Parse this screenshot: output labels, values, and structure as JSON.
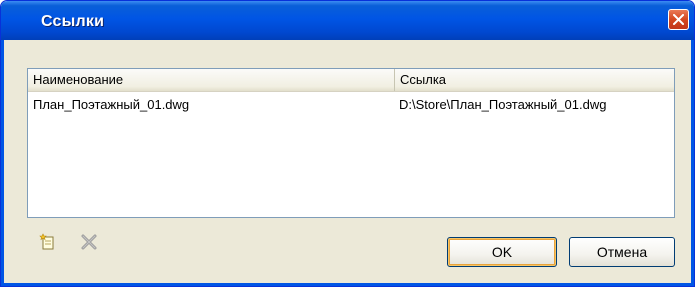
{
  "window": {
    "title": "Ссылки",
    "close_icon": "close-x-icon",
    "accent_color": "#0055e5"
  },
  "list": {
    "columns": [
      {
        "label": "Наименование"
      },
      {
        "label": "Ссылка"
      }
    ],
    "rows": [
      {
        "name": "План_Поэтажный_01.dwg",
        "link": "D:\\Store\\План_Поэтажный_01.dwg"
      }
    ]
  },
  "toolbar": {
    "add_icon": "new-link-icon",
    "delete_icon": "delete-icon"
  },
  "buttons": {
    "ok_label": "OK",
    "cancel_label": "Отмена"
  }
}
